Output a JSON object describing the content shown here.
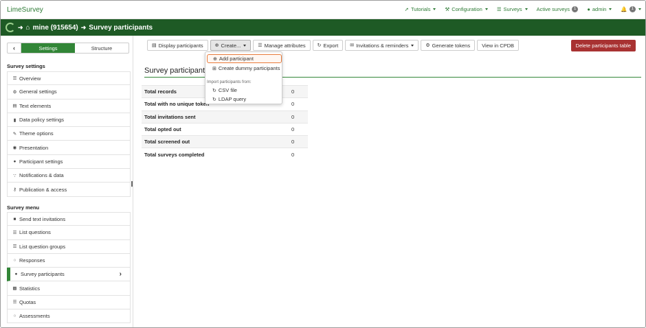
{
  "brand": "LimeSurvey",
  "topnav": {
    "tutorials": "Tutorials",
    "configuration": "Configuration",
    "surveys": "Surveys",
    "active_surveys": "Active surveys",
    "active_count": "1",
    "user": "admin",
    "notif_count": "1"
  },
  "breadcrumb": {
    "survey": "mine (915654)",
    "page": "Survey participants"
  },
  "sidebar": {
    "tab_settings": "Settings",
    "tab_structure": "Structure",
    "settings_heading": "Survey settings",
    "settings_items": [
      {
        "label": "Overview",
        "icon": "list-icon"
      },
      {
        "label": "General settings",
        "icon": "gears-icon"
      },
      {
        "label": "Text elements",
        "icon": "file-text-icon"
      },
      {
        "label": "Data policy settings",
        "icon": "shield-icon"
      },
      {
        "label": "Theme options",
        "icon": "paint-brush-icon"
      },
      {
        "label": "Presentation",
        "icon": "eye-slash-icon"
      },
      {
        "label": "Participant settings",
        "icon": "users-icon"
      },
      {
        "label": "Notifications & data",
        "icon": "feed-icon"
      },
      {
        "label": "Publication & access",
        "icon": "key-icon"
      }
    ],
    "menu_heading": "Survey menu",
    "menu_items": [
      {
        "label": "Send text invitations",
        "icon": "comment-icon"
      },
      {
        "label": "List questions",
        "icon": "list-icon"
      },
      {
        "label": "List question groups",
        "icon": "list-icon"
      },
      {
        "label": "Responses",
        "icon": "comment-o-icon"
      },
      {
        "label": "Survey participants",
        "icon": "user-icon"
      },
      {
        "label": "Statistics",
        "icon": "bar-chart-icon"
      },
      {
        "label": "Quotas",
        "icon": "tasks-icon"
      },
      {
        "label": "Assessments",
        "icon": "comment-o-icon"
      }
    ]
  },
  "toolbar": {
    "display_participants": "Display participants",
    "create": "Create...",
    "manage_attributes": "Manage attributes",
    "export": "Export",
    "invitations": "Invitations & reminders",
    "generate_tokens": "Generate tokens",
    "view_cpdb": "View in CPDB",
    "delete_table": "Delete participants table"
  },
  "dropdown": {
    "add_participant": "Add participant",
    "create_dummy": "Create dummy participants",
    "import_heading": "Import participants from:",
    "csv_file": "CSV file",
    "ldap_query": "LDAP query"
  },
  "main": {
    "title": "Survey participant s"
  },
  "stats": [
    {
      "label": "Total records",
      "value": "0"
    },
    {
      "label": "Total with no unique token",
      "value": "0"
    },
    {
      "label": "Total invitations sent",
      "value": "0"
    },
    {
      "label": "Total opted out",
      "value": "0"
    },
    {
      "label": "Total screened out",
      "value": "0"
    },
    {
      "label": "Total surveys completed",
      "value": "0"
    }
  ],
  "colors": {
    "brand_green": "#1e5a25",
    "accent_green": "#328637",
    "danger": "#a83232",
    "highlight": "#e87a3a"
  }
}
